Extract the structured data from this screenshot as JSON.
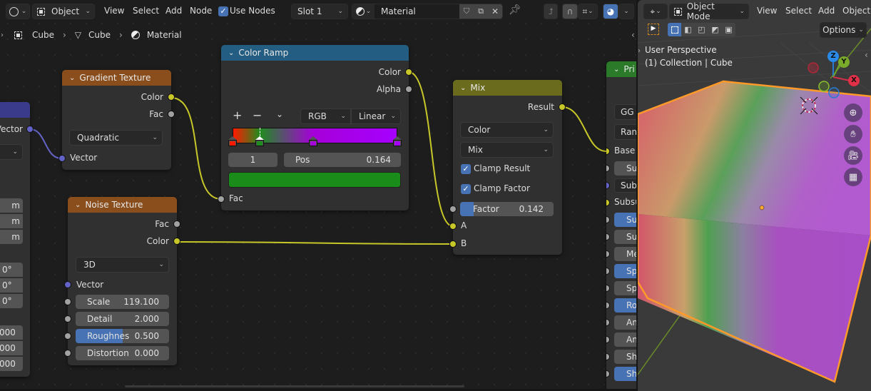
{
  "node_header": {
    "editor_type_icon": "shader-editor-icon",
    "object_mode": "Object",
    "menus": [
      "View",
      "Select",
      "Add",
      "Node"
    ],
    "use_nodes_label": "Use Nodes",
    "use_nodes_checked": true,
    "slot": "Slot 1",
    "material_name": "Material"
  },
  "breadcrumb": [
    "Cube",
    "Cube",
    "Material"
  ],
  "nodes": {
    "left_partial": {
      "output_vector": "Vector",
      "location_values": [
        "m",
        "m",
        "m"
      ],
      "rotation_values": [
        "0°",
        "0°",
        "0°"
      ],
      "scale_values": [
        "000",
        "000",
        "000"
      ]
    },
    "gradient_texture": {
      "title": "Gradient Texture",
      "outputs": [
        "Color",
        "Fac"
      ],
      "type": "Quadratic",
      "input_vector": "Vector"
    },
    "noise_texture": {
      "title": "Noise Texture",
      "outputs": [
        "Fac",
        "Color"
      ],
      "dimensions": "3D",
      "input_vector": "Vector",
      "fields": [
        {
          "label": "Scale",
          "value": "119.100"
        },
        {
          "label": "Detail",
          "value": "2.000"
        },
        {
          "label": "Roughnes",
          "value": "0.500",
          "fill": 0.5
        },
        {
          "label": "Distortion",
          "value": "0.000"
        }
      ]
    },
    "color_ramp": {
      "title": "Color Ramp",
      "outputs": [
        "Color",
        "Alpha"
      ],
      "add": "+",
      "remove": "−",
      "color_mode": "RGB",
      "interpolation": "Linear",
      "stops": [
        {
          "pos": 0.0,
          "color": "#ff1a00"
        },
        {
          "pos": 0.164,
          "color": "#1f8c1f"
        },
        {
          "pos": 0.49,
          "color": "#a600d9"
        },
        {
          "pos": 1.0,
          "color": "#a600ff"
        }
      ],
      "active_index": "1",
      "pos_label": "Pos",
      "pos_value": "0.164",
      "active_color": "#1a8c1a",
      "input_fac": "Fac"
    },
    "mix": {
      "title": "Mix",
      "output": "Result",
      "data_type": "Color",
      "blend_mode": "Mix",
      "clamp_result_label": "Clamp Result",
      "clamp_factor_label": "Clamp Factor",
      "factor_label": "Factor",
      "factor_value": "0.142",
      "factor_fill": 0.142,
      "input_a": "A",
      "input_b": "B"
    },
    "principled": {
      "title_partial": "Pri",
      "distribution_partial": "GG",
      "subsurface_method_partial": "Ran",
      "inputs_partial": [
        "Base",
        "Su",
        "Sub",
        "Subsu",
        "Su",
        "Su",
        "Me",
        "Sp",
        "Sp",
        "Ro",
        "An",
        "An",
        "Sh",
        "Sh"
      ]
    }
  },
  "viewport_header": {
    "editor_type_icon": "viewport-icon",
    "mode": "Object Mode",
    "menus": [
      "View",
      "Select",
      "Add",
      "Object"
    ],
    "options": "Options"
  },
  "viewport": {
    "perspective": "User Perspective",
    "collection": "(1) Collection | Cube",
    "gizmo_axes": [
      "X",
      "Y",
      "Z"
    ],
    "nav_buttons": [
      "zoom-icon",
      "pan-hand-icon",
      "camera-icon",
      "grid-icon"
    ]
  }
}
